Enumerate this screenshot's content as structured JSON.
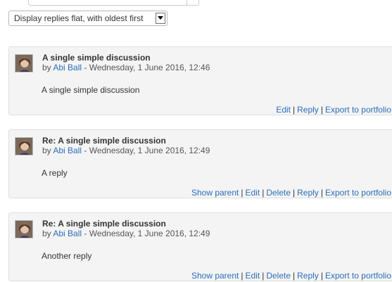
{
  "display_mode": {
    "selected": "Display replies flat, with oldest first"
  },
  "posts": [
    {
      "subject": "A single simple discussion",
      "by_prefix": "by",
      "author": "Abi Ball",
      "date": "- Wednesday, 1 June 2016, 12:46",
      "message": "A single simple discussion",
      "commands": [
        "Edit",
        "Reply",
        "Export to portfolio"
      ]
    },
    {
      "subject": "Re: A single simple discussion",
      "by_prefix": "by",
      "author": "Abi Ball",
      "date": "- Wednesday, 1 June 2016, 12:49",
      "message": "A reply",
      "commands": [
        "Show parent",
        "Edit",
        "Delete",
        "Reply",
        "Export to portfolio"
      ]
    },
    {
      "subject": "Re: A single simple discussion",
      "by_prefix": "by",
      "author": "Abi Ball",
      "date": "- Wednesday, 1 June 2016, 12:49",
      "message": "Another reply",
      "commands": [
        "Show parent",
        "Edit",
        "Delete",
        "Reply",
        "Export to portfolio"
      ]
    }
  ],
  "colors": {
    "link": "#2a6ebb",
    "post_background": "#f4f4f4",
    "post_border": "#dddddd"
  }
}
